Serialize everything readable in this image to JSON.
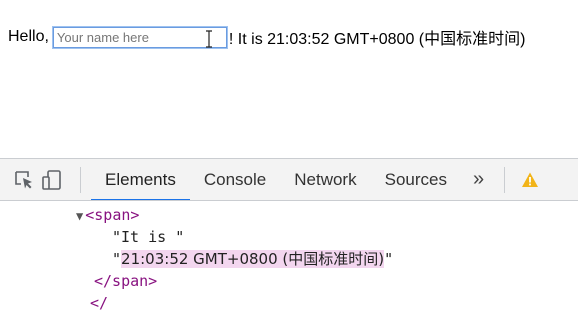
{
  "page": {
    "hello_prefix": "Hello,",
    "name_input": {
      "placeholder": "Your name here",
      "value": ""
    },
    "time_sentence": "! It is 21:03:52 GMT+0800 (中国标准时间)"
  },
  "devtools": {
    "toolbar": {
      "icons": [
        "inspect-element-icon",
        "device-toolbar-icon",
        "more-tabs-icon",
        "warning-icon"
      ],
      "tabs": [
        {
          "label": "Elements",
          "active": true
        },
        {
          "label": "Console",
          "active": false
        },
        {
          "label": "Network",
          "active": false
        },
        {
          "label": "Sources",
          "active": false
        }
      ],
      "more_tabs_glyph": "»",
      "warning_glyph": "!"
    },
    "dom_tree": {
      "open_tag": "<span>",
      "text_node_1": "\"It is \"",
      "quote": "\"",
      "text_node_2": "21:03:52 GMT+0800 (中国标准时间)",
      "close_tag": "</span>",
      "trailing_tag": "</",
      "expand_arrow": "▼"
    },
    "colors": {
      "tag": "#881280",
      "active_tab_underline": "#1a73e8",
      "highlight": "#f3d6ef",
      "warning": "#f2b418"
    }
  }
}
